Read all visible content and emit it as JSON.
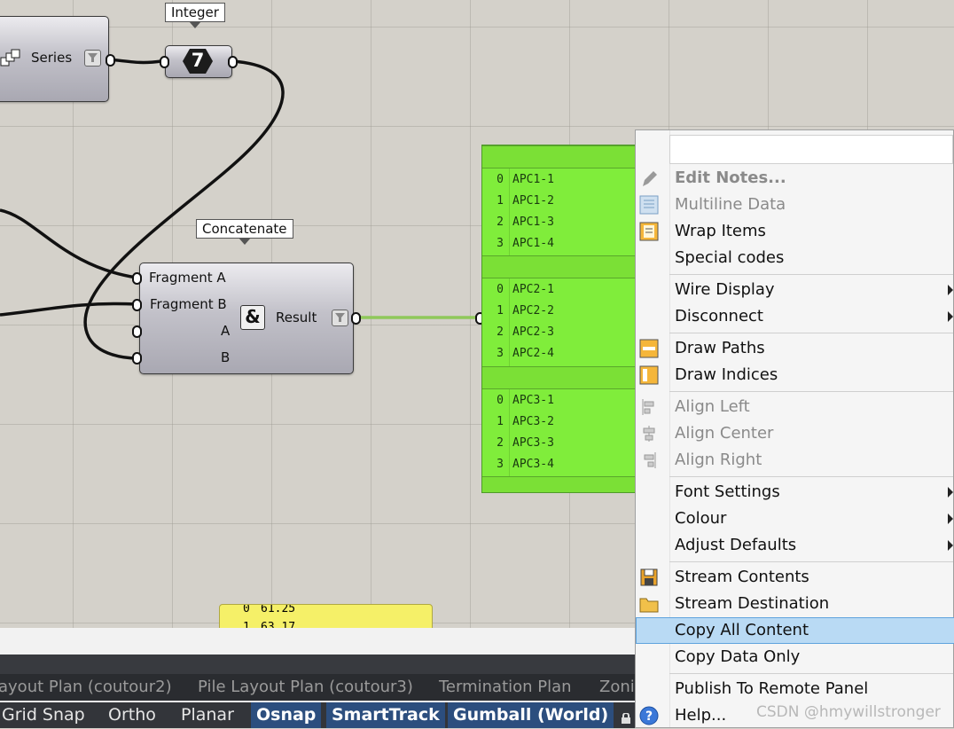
{
  "canvas": {
    "tooltips": {
      "integer": "Integer",
      "concatenate": "Concatenate"
    },
    "series_component": {
      "label": "Series"
    },
    "integer_component": {
      "value": "7"
    },
    "concatenate_component": {
      "inputs": [
        "Fragment A",
        "Fragment B",
        "A",
        "B"
      ],
      "symbol": "&",
      "output": "Result"
    },
    "panel": {
      "groups": [
        {
          "rows": [
            {
              "i": "0",
              "v": "APC1-1"
            },
            {
              "i": "1",
              "v": "APC1-2"
            },
            {
              "i": "2",
              "v": "APC1-3"
            },
            {
              "i": "3",
              "v": "APC1-4"
            }
          ]
        },
        {
          "rows": [
            {
              "i": "0",
              "v": "APC2-1"
            },
            {
              "i": "1",
              "v": "APC2-2"
            },
            {
              "i": "2",
              "v": "APC2-3"
            },
            {
              "i": "3",
              "v": "APC2-4"
            }
          ]
        },
        {
          "rows": [
            {
              "i": "0",
              "v": "APC3-1"
            },
            {
              "i": "1",
              "v": "APC3-2"
            },
            {
              "i": "2",
              "v": "APC3-3"
            },
            {
              "i": "3",
              "v": "APC3-4"
            }
          ]
        }
      ]
    },
    "yellow_panel": {
      "rows": [
        {
          "i": "0",
          "v": "61.25"
        },
        {
          "i": "1",
          "v": "63.17"
        }
      ]
    }
  },
  "statusbar": {
    "layout_tabs": [
      "ayout Plan (coutour2)",
      "Pile Layout Plan (coutour3)",
      "Termination Plan",
      "Zoni"
    ],
    "toggles": [
      {
        "label": "Grid Snap",
        "on": false
      },
      {
        "label": "Ortho",
        "on": false
      },
      {
        "label": "Planar",
        "on": false
      },
      {
        "label": "Osnap",
        "on": true
      },
      {
        "label": "SmartTrack",
        "on": true
      },
      {
        "label": "Gumball (World)",
        "on": true
      }
    ]
  },
  "menu": {
    "items": [
      {
        "label": "Edit Notes...",
        "icon": "pencil-icon"
      },
      {
        "label": "Multiline Data",
        "icon": "multiline-icon"
      },
      {
        "label": "Wrap Items",
        "icon": "wrap-icon"
      },
      {
        "label": "Special codes"
      },
      {
        "label": "Wire Display"
      },
      {
        "label": "Disconnect"
      },
      {
        "label": "Draw Paths",
        "icon": "paths-icon"
      },
      {
        "label": "Draw Indices",
        "icon": "indices-icon"
      },
      {
        "label": "Align Left",
        "icon": "align-left-icon"
      },
      {
        "label": "Align Center",
        "icon": "align-center-icon"
      },
      {
        "label": "Align Right",
        "icon": "align-right-icon"
      },
      {
        "label": "Font Settings"
      },
      {
        "label": "Colour"
      },
      {
        "label": "Adjust Defaults"
      },
      {
        "label": "Stream Contents",
        "icon": "save-icon"
      },
      {
        "label": "Stream Destination",
        "icon": "folder-icon"
      },
      {
        "label": "Copy All Content"
      },
      {
        "label": "Copy Data Only"
      },
      {
        "label": "Publish To Remote Panel"
      },
      {
        "label": "Help...",
        "icon": "help-icon"
      }
    ],
    "highlight_color": "#b9daf4"
  },
  "watermark": "CSDN @hmywillstronger"
}
